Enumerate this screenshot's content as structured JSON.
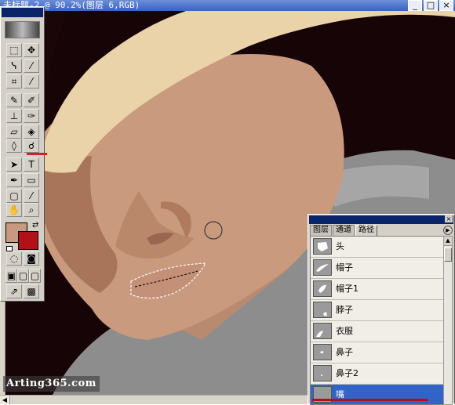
{
  "window": {
    "title": "未标题-2 @ 90.2%(图层 6,RGB)",
    "buttons": {
      "minimize": "_",
      "maximize": "□",
      "close": "×"
    }
  },
  "watermark": "Arting365.com",
  "colors": {
    "foreground": "#c79a7f",
    "background": "#b01218",
    "titlebar": "#3a62c4",
    "selected_row": "#3264c8"
  },
  "toolbox": {
    "tools": [
      {
        "icon": "marquee-icon",
        "glyph": "⬚"
      },
      {
        "icon": "move-icon",
        "glyph": "✥"
      },
      {
        "icon": "lasso-icon",
        "glyph": "ᓭ"
      },
      {
        "icon": "magic-wand-icon",
        "glyph": "⁄"
      },
      {
        "icon": "crop-icon",
        "glyph": "⌗"
      },
      {
        "icon": "slice-icon",
        "glyph": "⁄"
      },
      {
        "icon": "healing-brush-icon",
        "glyph": "✎"
      },
      {
        "icon": "brush-icon",
        "glyph": "✐"
      },
      {
        "icon": "clone-stamp-icon",
        "glyph": "⊥"
      },
      {
        "icon": "history-brush-icon",
        "glyph": "✑"
      },
      {
        "icon": "eraser-icon",
        "glyph": "▱"
      },
      {
        "icon": "paint-bucket-icon",
        "glyph": "◈"
      },
      {
        "icon": "blur-icon",
        "glyph": "◊"
      },
      {
        "icon": "dodge-icon",
        "glyph": "☌"
      },
      {
        "icon": "path-select-icon",
        "glyph": "➤"
      },
      {
        "icon": "type-icon",
        "glyph": "T"
      },
      {
        "icon": "pen-icon",
        "glyph": "✒"
      },
      {
        "icon": "shape-icon",
        "glyph": "▭"
      },
      {
        "icon": "notes-icon",
        "glyph": "▢"
      },
      {
        "icon": "eyedropper-icon",
        "glyph": "⁄"
      },
      {
        "icon": "hand-icon",
        "glyph": "✋"
      },
      {
        "icon": "zoom-icon",
        "glyph": "⌕"
      }
    ],
    "mode_buttons": [
      {
        "icon": "standard-mode-icon",
        "glyph": "◌"
      },
      {
        "icon": "quick-mask-icon",
        "glyph": "◙"
      }
    ],
    "screen_buttons": [
      {
        "icon": "screen-mode-standard-icon",
        "glyph": "▣"
      },
      {
        "icon": "screen-mode-full-menu-icon",
        "glyph": "▢"
      },
      {
        "icon": "screen-mode-full-icon",
        "glyph": "▢"
      }
    ],
    "bottom_buttons": [
      {
        "icon": "jump-to-imageready-icon",
        "glyph": "⇗"
      },
      {
        "icon": "imageready-icon",
        "glyph": "▩"
      }
    ],
    "swap_glyph": "⇄"
  },
  "panel": {
    "tabs": [
      "图层",
      "通道",
      "路径"
    ],
    "active_tab": 2,
    "close": "×",
    "menu_glyph": "▶",
    "paths": [
      {
        "name": "头",
        "thumb": "head"
      },
      {
        "name": "帽子",
        "thumb": "hat"
      },
      {
        "name": "帽子1",
        "thumb": "hat1"
      },
      {
        "name": "脖子",
        "thumb": "neck"
      },
      {
        "name": "衣服",
        "thumb": "clothes"
      },
      {
        "name": "鼻子",
        "thumb": "nose"
      },
      {
        "name": "鼻子2",
        "thumb": "nose2"
      },
      {
        "name": "嘴",
        "thumb": "mouth",
        "selected": true
      }
    ],
    "scroll_up": "▲"
  }
}
